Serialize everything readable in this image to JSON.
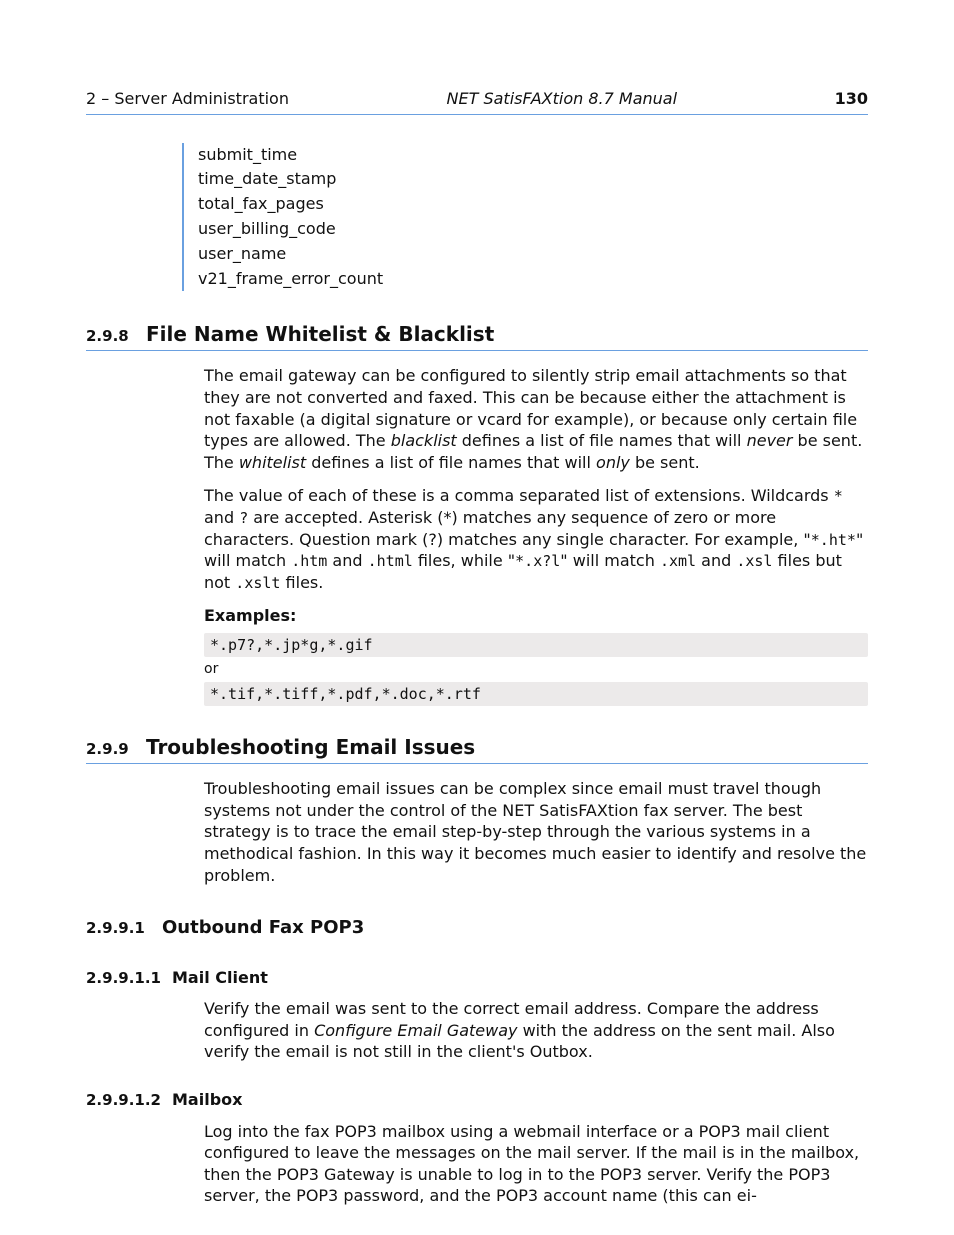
{
  "header": {
    "left": "2 – Server Administration",
    "center": "NET SatisFAXtion 8.7 Manual",
    "page_number": "130"
  },
  "field_list": [
    "submit_time",
    "time_date_stamp",
    "total_fax_pages",
    "user_billing_code",
    "user_name",
    "v21_frame_error_count"
  ],
  "sections": {
    "s298": {
      "num": "2.9.8",
      "title": "File Name Whitelist & Blacklist",
      "p1_a": "The email gateway can be configured to silently strip email attachments so that they are not converted and faxed. This can be because either the attachment is not faxable (a digital signature or vcard for example), or because only certain file types are allowed. The ",
      "p1_blacklist": "blacklist",
      "p1_b": " defines a list of file names that will ",
      "p1_never": "never",
      "p1_c": " be sent. The ",
      "p1_whitelist": "whitelist",
      "p1_d": " defines a list of file names that will ",
      "p1_only": "only",
      "p1_e": " be sent.",
      "p2_a": "The value of each of these is a comma separated list of extensions. Wildcards ",
      "p2_star": "*",
      "p2_b": " and ",
      "p2_q": "?",
      "p2_c": " are accepted. Asterisk (*) matches any sequence of zero or more characters. Question mark (?) matches any single character. For example, \"",
      "p2_ex1": "*.ht*",
      "p2_d": "\" will match ",
      "p2_htm": ".htm",
      "p2_e": " and ",
      "p2_html": ".html",
      "p2_f": " files, while \"",
      "p2_ex2": "*.x?l",
      "p2_g": "\" will match ",
      "p2_xml": ".xml",
      "p2_h": " and ",
      "p2_xsl": ".xsl",
      "p2_i": " files but not ",
      "p2_xslt": ".xslt",
      "p2_j": " files.",
      "examples_label": "Examples:",
      "example1": "*.p7?,*.jp*g,*.gif",
      "or": "or",
      "example2": "*.tif,*.tiff,*.pdf,*.doc,*.rtf"
    },
    "s299": {
      "num": "2.9.9",
      "title": "Troubleshooting Email Issues",
      "p1": "Troubleshooting email issues can be complex since email must travel though systems not under the control of the NET SatisFAXtion fax server. The best strategy is to trace the email step-by-step through the various systems in a methodical fashion. In this way it becomes much easier to identify and resolve the problem."
    },
    "s2991": {
      "num": "2.9.9.1",
      "title": "Outbound Fax POP3"
    },
    "s29911": {
      "num": "2.9.9.1.1",
      "title": "Mail Client",
      "p1_a": "Verify the email was sent to the correct email address. Compare the address configured in ",
      "p1_i": "Configure Email Gateway",
      "p1_b": " with the address on the sent mail. Also verify the email is not still in the client's Outbox."
    },
    "s29912": {
      "num": "2.9.9.1.2",
      "title": "Mailbox",
      "p1": "Log into the fax POP3 mailbox using a webmail interface or a POP3 mail client configured to leave the messages on the mail server. If the mail is in the mailbox, then the POP3 Gateway is unable to log in to the POP3 server. Verify the POP3 server, the POP3 password, and the POP3 account name (this can ei-"
    }
  }
}
